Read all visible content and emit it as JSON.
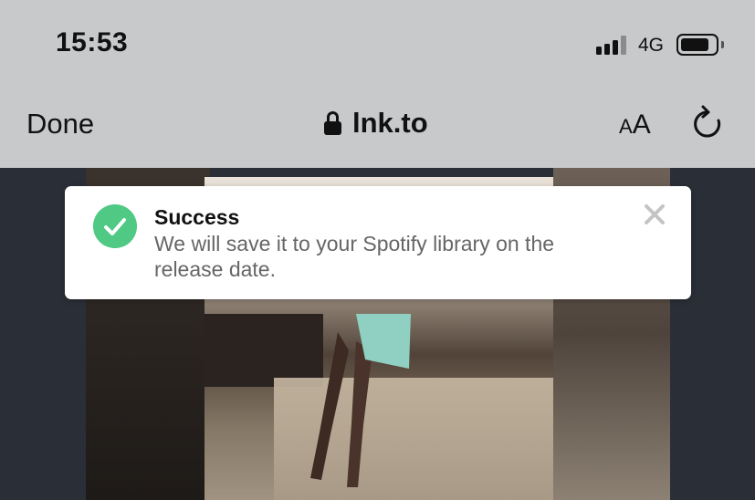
{
  "status_bar": {
    "time": "15:53",
    "network": "4G",
    "signal_icon": "cellular-signal-icon",
    "battery_icon": "battery-icon"
  },
  "nav_bar": {
    "done_label": "Done",
    "url": "lnk.to",
    "lock_icon": "lock-icon",
    "text_size_small": "A",
    "text_size_big": "A",
    "reload_icon": "reload-icon"
  },
  "toast": {
    "icon": "check-circle-icon",
    "title": "Success",
    "message": "We will save it to your Spotify library on the release date.",
    "close_icon": "close-icon",
    "accent_color": "#4fc983"
  }
}
